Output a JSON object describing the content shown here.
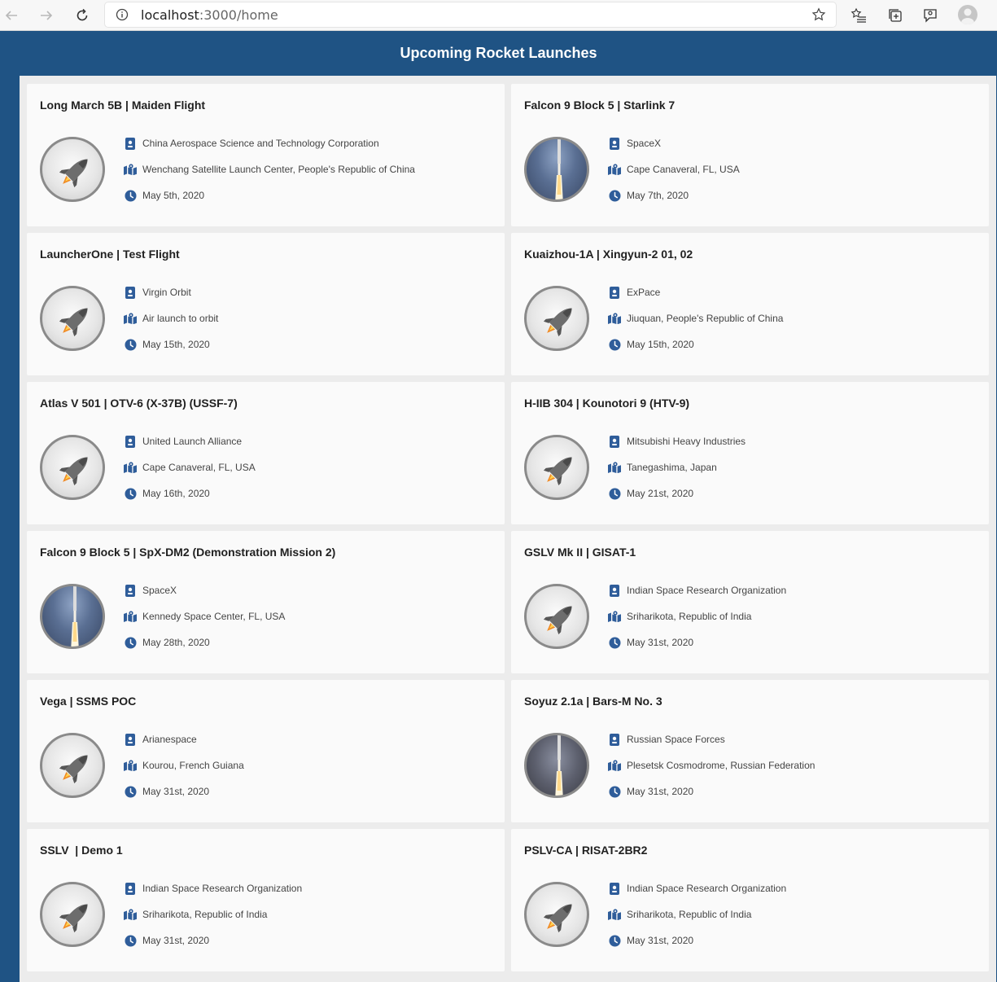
{
  "browser": {
    "url_host": "localhost",
    "url_rest": ":3000/home"
  },
  "header": {
    "title": "Upcoming Rocket Launches"
  },
  "colors": {
    "brand": "#1f5384",
    "icon": "#2f5d9a"
  },
  "launches": [
    {
      "title": "Long March 5B | Maiden Flight",
      "agency": "China Aerospace Science and Technology Corporation",
      "location": "Wenchang Satellite Launch Center, People's Republic of China",
      "date": "May 5th, 2020",
      "image": "rocket-placeholder-icon"
    },
    {
      "title": "Falcon 9 Block 5 | Starlink 7",
      "agency": "SpaceX",
      "location": "Cape Canaveral, FL, USA",
      "date": "May 7th, 2020",
      "image": "launch-photo"
    },
    {
      "title": "LauncherOne | Test Flight",
      "agency": "Virgin Orbit",
      "location": "Air launch to orbit",
      "date": "May 15th, 2020",
      "image": "rocket-placeholder-icon"
    },
    {
      "title": "Kuaizhou-1A | Xingyun-2 01, 02",
      "agency": "ExPace",
      "location": "Jiuquan, People's Republic of China",
      "date": "May 15th, 2020",
      "image": "rocket-placeholder-icon"
    },
    {
      "title": "Atlas V 501 | OTV-6 (X-37B) (USSF-7)",
      "agency": "United Launch Alliance",
      "location": "Cape Canaveral, FL, USA",
      "date": "May 16th, 2020",
      "image": "rocket-placeholder-icon"
    },
    {
      "title": "H-IIB 304 | Kounotori 9 (HTV-9)",
      "agency": "Mitsubishi Heavy Industries",
      "location": "Tanegashima, Japan",
      "date": "May 21st, 2020",
      "image": "rocket-placeholder-icon"
    },
    {
      "title": "Falcon 9 Block 5 | SpX-DM2 (Demonstration Mission 2)",
      "agency": "SpaceX",
      "location": "Kennedy Space Center, FL, USA",
      "date": "May 28th, 2020",
      "image": "launch-photo"
    },
    {
      "title": "GSLV Mk II | GISAT-1",
      "agency": "Indian Space Research Organization",
      "location": "Sriharikota, Republic of India",
      "date": "May 31st, 2020",
      "image": "rocket-placeholder-icon"
    },
    {
      "title": "Vega | SSMS POC",
      "agency": "Arianespace",
      "location": "Kourou, French Guiana",
      "date": "May 31st, 2020",
      "image": "rocket-placeholder-icon"
    },
    {
      "title": "Soyuz 2.1a | Bars-M No. 3",
      "agency": "Russian Space Forces",
      "location": "Plesetsk Cosmodrome, Russian Federation",
      "date": "May 31st, 2020",
      "image": "launch-photo"
    },
    {
      "title": "SSLV  | Demo 1",
      "agency": "Indian Space Research Organization",
      "location": "Sriharikota, Republic of India",
      "date": "May 31st, 2020",
      "image": "rocket-placeholder-icon"
    },
    {
      "title": "PSLV-CA | RISAT-2BR2",
      "agency": "Indian Space Research Organization",
      "location": "Sriharikota, Republic of India",
      "date": "May 31st, 2020",
      "image": "rocket-placeholder-icon"
    }
  ]
}
